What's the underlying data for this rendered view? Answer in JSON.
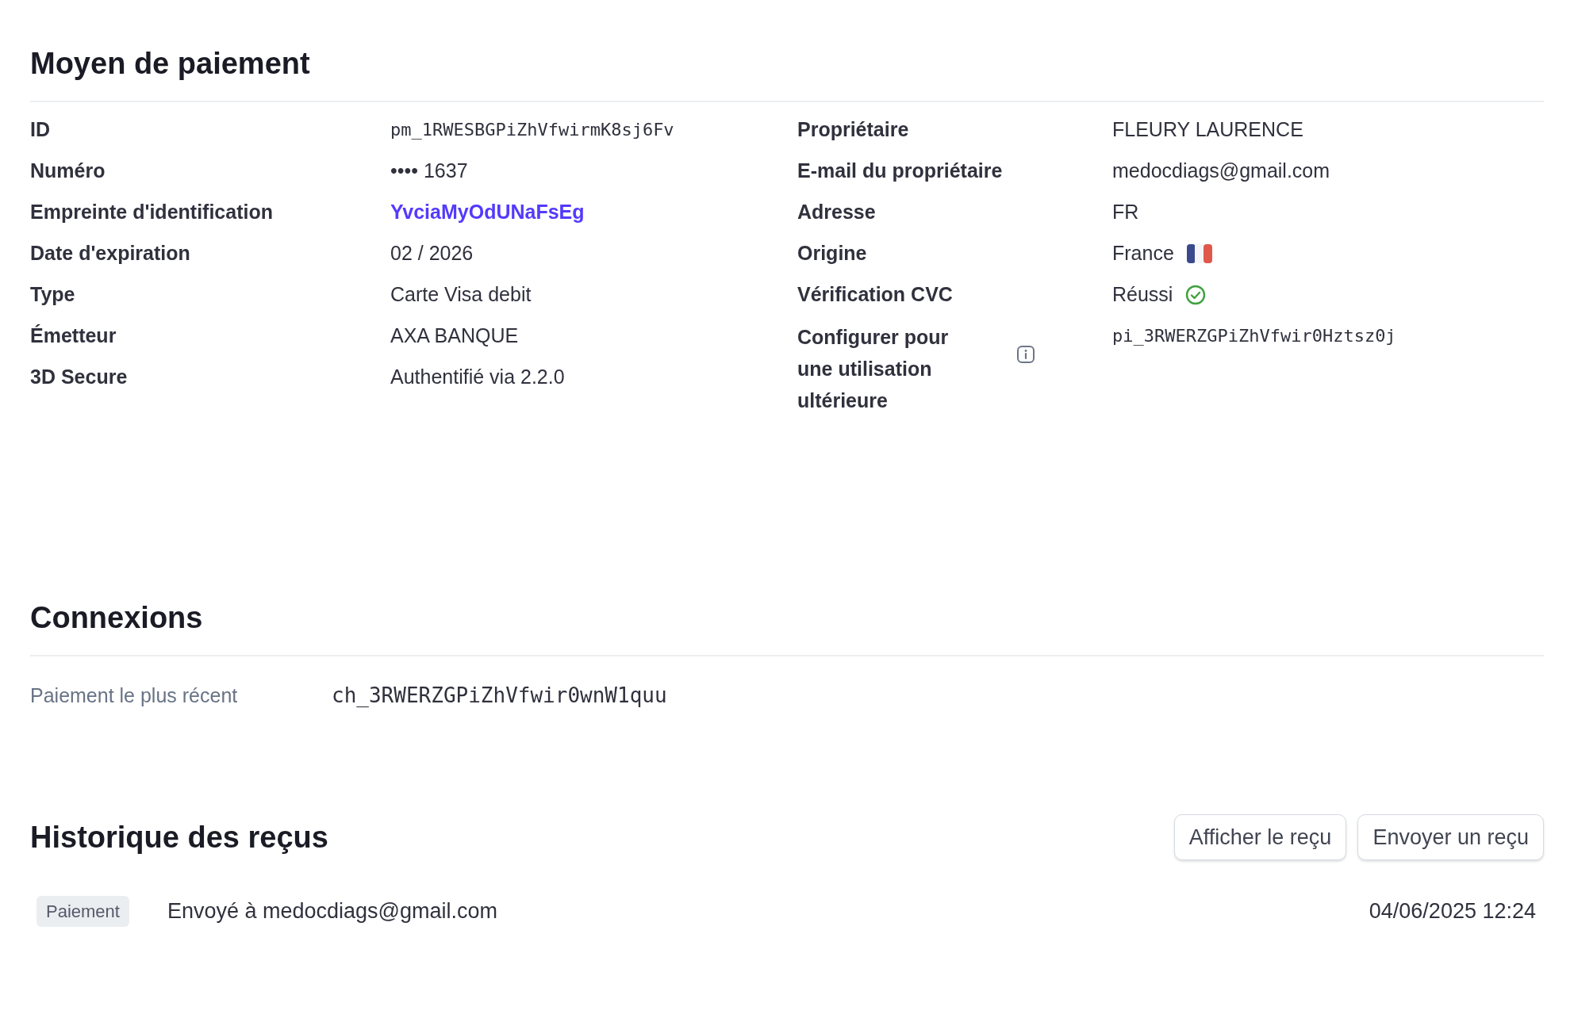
{
  "payment_method": {
    "title": "Moyen de paiement",
    "left_rows": [
      {
        "label": "ID",
        "value": "pm_1RWESBGPiZhVfwirmK8sj6Fv",
        "kind": "mono"
      },
      {
        "label": "Numéro",
        "value": "•••• 1637",
        "kind": "text"
      },
      {
        "label": "Empreinte d'identification",
        "value": "YvciaMyOdUNaFsEg",
        "kind": "link"
      },
      {
        "label": "Date d'expiration",
        "value": "02 / 2026",
        "kind": "text"
      },
      {
        "label": "Type",
        "value": "Carte Visa debit",
        "kind": "text"
      },
      {
        "label": "Émetteur",
        "value": "AXA BANQUE",
        "kind": "text"
      },
      {
        "label": "3D Secure",
        "value": "Authentifié via 2.2.0",
        "kind": "text"
      }
    ],
    "right_rows": [
      {
        "label": "Propriétaire",
        "value": "FLEURY LAURENCE",
        "kind": "text"
      },
      {
        "label": "E-mail du propriétaire",
        "value": "medocdiags@gmail.com",
        "kind": "text"
      },
      {
        "label": "Adresse",
        "value": "FR",
        "kind": "text"
      },
      {
        "label": "Origine",
        "value": "France",
        "kind": "flag"
      },
      {
        "label": "Vérification CVC",
        "value": "Réussi",
        "kind": "check"
      },
      {
        "label": "Configurer pour une utilisation ultérieure",
        "value": "pi_3RWERZGPiZhVfwir0Hztsz0j",
        "kind": "mono_info"
      }
    ]
  },
  "connections": {
    "title": "Connexions",
    "rows": [
      {
        "label": "Paiement le plus récent",
        "value": "ch_3RWERZGPiZhVfwir0wnW1quu"
      }
    ]
  },
  "receipts": {
    "title": "Historique des reçus",
    "buttons": [
      "Afficher le reçu",
      "Envoyer un reçu"
    ],
    "rows": [
      {
        "badge": "Paiement",
        "text": "Envoyé à medocdiags@gmail.com",
        "date": "04/06/2025 12:24"
      }
    ]
  }
}
